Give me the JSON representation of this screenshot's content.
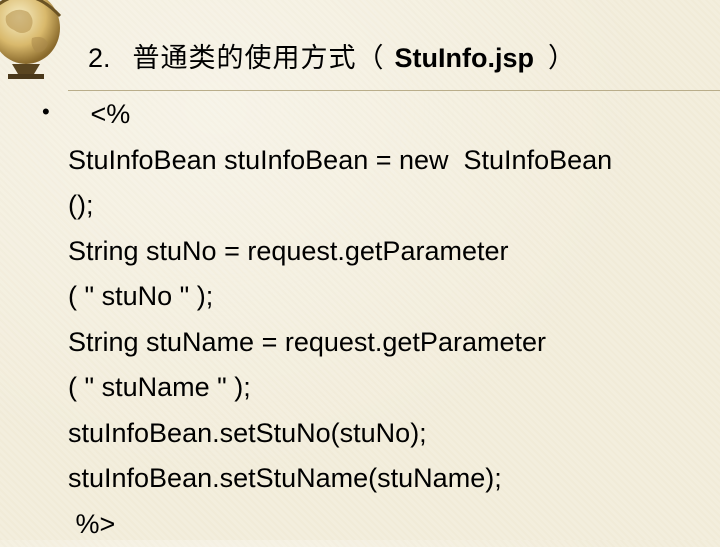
{
  "title": {
    "number": "2.",
    "chinese": "普通类的使用方式（",
    "filename": "StuInfo.jsp",
    "close": "）"
  },
  "bullet": "•",
  "code_lines": [
    "   <%",
    "StuInfoBean stuInfoBean = new  StuInfoBean",
    "();",
    "String stuNo = request.getParameter",
    "( \" stuNo \" );",
    "String stuName = request.getParameter",
    "( \" stuName \" );",
    "stuInfoBean.setStuNo(stuNo);",
    "stuInfoBean.setStuName(stuName);",
    " %>"
  ]
}
